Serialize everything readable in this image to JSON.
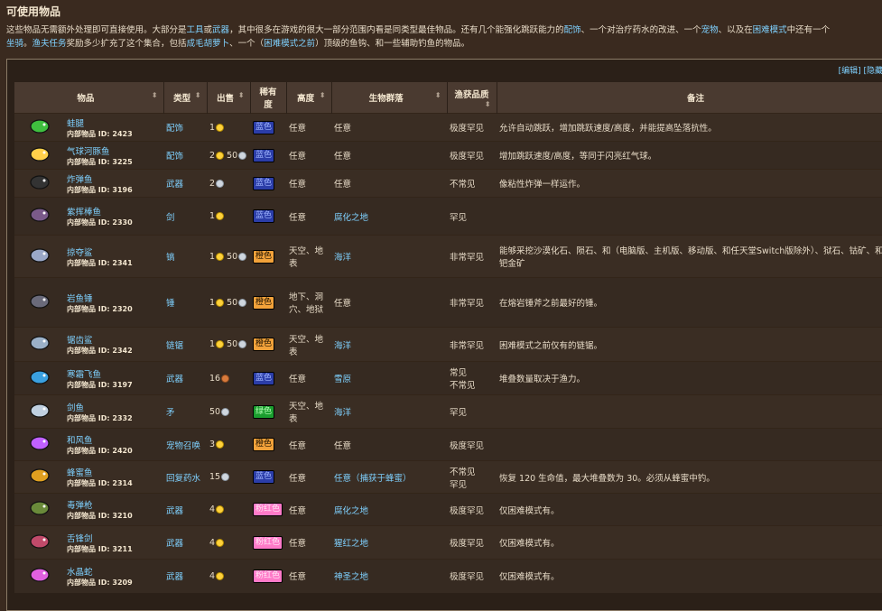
{
  "section_title": "可使用物品",
  "intro": {
    "line1_a": "这些物品无需额外处理即可直接使用。大部分是",
    "line1_link1": "工具",
    "line1_b": "或",
    "line1_link2": "武器",
    "line1_c": "，其中很多在游戏的很大一部分范围内看是同类型最佳物品。还有几个能强化跳跃能力的",
    "line1_link3": "配饰",
    "line1_d": "、一个对治疗药水的改进、一个",
    "line1_link4": "宠物",
    "line1_e": "、以及在",
    "line1_link5": "困难模式",
    "line1_f": "中还有一个",
    "line2_link1": "坐骑",
    "line2_a": "。",
    "line2_link2": "渔夫任务",
    "line2_b": "奖励多少扩充了这个集合，包括",
    "line2_link3": "成毛胡萝卜",
    "line2_c": "、一个（",
    "line2_link4": "困难模式之前",
    "line2_d": "）顶级的鱼钩、和一些辅助钓鱼的物品。"
  },
  "edit_links": {
    "edit": "[编辑]",
    "hide": "[隐藏"
  },
  "table": {
    "headers": {
      "item": "物品",
      "type": "类型",
      "sell": "出售",
      "rarity": "稀有度",
      "height": "高度",
      "biome": "生物群落",
      "quality": "渔获品质",
      "notes": "备注"
    },
    "rows": [
      {
        "name": "蛙腿",
        "id_label": "内部物品 ID:",
        "id": "2423",
        "type": "配饰",
        "sell": "1",
        "coin": "gold",
        "rarity": "蓝色",
        "rarity_class": "r-blue",
        "height": "任意",
        "biome": "任意",
        "quality": "极度罕见",
        "notes": "允许自动跳跃，增加跳跃速度/高度，并能提高坠落抗性。",
        "icon": "frog-leg-icon",
        "icon_color": "#3fbf3f"
      },
      {
        "name": "气球河豚鱼",
        "id_label": "内部物品 ID:",
        "id": "3225",
        "type": "配饰",
        "sell": "2",
        "sell2": "50",
        "coin": "gold",
        "rarity": "蓝色",
        "rarity_class": "r-blue",
        "height": "任意",
        "biome": "任意",
        "quality": "极度罕见",
        "notes": "增加跳跃速度/高度，等同于闪亮红气球。",
        "icon": "balloon-pufferfish-icon",
        "icon_color": "#ffd04a"
      },
      {
        "name": "炸弹鱼",
        "id_label": "内部物品 ID:",
        "id": "3196",
        "type": "武器",
        "sell": "2",
        "coin": "silver",
        "rarity": "蓝色",
        "rarity_class": "r-blue",
        "height": "任意",
        "biome": "任意",
        "quality": "不常见",
        "notes": "像粘性炸弹一样运作。",
        "icon": "bomb-fish-icon",
        "icon_color": "#333333"
      },
      {
        "name": "紫挥棒鱼",
        "id_label": "内部物品 ID:",
        "id": "2330",
        "type": "剑",
        "sell": "1",
        "coin": "gold",
        "rarity": "蓝色",
        "rarity_class": "r-blue",
        "height": "任意",
        "biome": "腐化之地",
        "quality": "罕见",
        "notes": "",
        "icon": "purple-clubberfish-icon",
        "icon_color": "#7a5a8a"
      },
      {
        "name": "掠夺鲨",
        "id_label": "内部物品 ID:",
        "id": "2341",
        "type": "镐",
        "sell": "1",
        "sell2": "50",
        "coin": "gold",
        "rarity": "橙色",
        "rarity_class": "r-orange",
        "height": "天空、地表",
        "biome": "海洋",
        "quality": "非常罕见",
        "notes": "能够采挖沙漠化石、陨石、和（电脑版、主机版、移动版、和任天堂Switch版除外）、狱石、钴矿、和钯金矿",
        "icon": "reaver-shark-icon",
        "icon_color": "#9aa8c8"
      },
      {
        "name": "岩鱼锤",
        "id_label": "内部物品 ID:",
        "id": "2320",
        "type": "锤",
        "sell": "1",
        "sell2": "50",
        "coin": "gold",
        "rarity": "橙色",
        "rarity_class": "r-orange",
        "height": "地下、洞穴、地狱",
        "biome": "任意",
        "quality": "非常罕见",
        "notes": "在熔岩锤斧之前最好的锤。",
        "icon": "rockfish-icon",
        "icon_color": "#6a6a7a"
      },
      {
        "name": "锯齿鲨",
        "id_label": "内部物品 ID:",
        "id": "2342",
        "type": "链锯",
        "sell": "1",
        "sell2": "50",
        "coin": "gold",
        "rarity": "橙色",
        "rarity_class": "r-orange",
        "height": "天空、地表",
        "biome": "海洋",
        "quality": "非常罕见",
        "notes": "困难模式之前仅有的链锯。",
        "icon": "sawtooth-shark-icon",
        "icon_color": "#9ab0c8"
      },
      {
        "name": "寒霜飞鱼",
        "id_label": "内部物品 ID:",
        "id": "3197",
        "type": "武器",
        "sell": "16",
        "coin": "copper",
        "rarity": "蓝色",
        "rarity_class": "r-blue",
        "height": "任意",
        "biome": "雪原",
        "quality": "常见\n不常见",
        "notes": "堆叠数量取决于渔力。",
        "icon": "frost-daggerfish-icon",
        "icon_color": "#3aa0e0"
      },
      {
        "name": "剑鱼",
        "id_label": "内部物品 ID:",
        "id": "2332",
        "type": "矛",
        "sell": "50",
        "coin": "silver",
        "rarity": "绿色",
        "rarity_class": "r-green",
        "height": "天空、地表",
        "biome": "海洋",
        "quality": "罕见",
        "notes": "",
        "icon": "swordfish-icon",
        "icon_color": "#c0d0e0"
      },
      {
        "name": "和风鱼",
        "id_label": "内部物品 ID:",
        "id": "2420",
        "type": "宠物召唤",
        "sell": "3",
        "coin": "gold",
        "rarity": "橙色",
        "rarity_class": "r-orange",
        "height": "任意",
        "biome": "任意",
        "quality": "极度罕见",
        "notes": "",
        "icon": "zephyr-fish-icon",
        "icon_color": "#c060ff"
      },
      {
        "name": "蜂蜜鱼",
        "id_label": "内部物品 ID:",
        "id": "2314",
        "type": "回复药水",
        "sell": "15",
        "coin": "silver",
        "rarity": "蓝色",
        "rarity_class": "r-blue",
        "height": "任意",
        "biome": "任意（捕获于蜂蜜）",
        "quality": "不常见\n罕见",
        "notes": "恢复 120 生命值，最大堆叠数为 30。必须从蜂蜜中钓。",
        "icon": "honeyfin-icon",
        "icon_color": "#e0a020"
      },
      {
        "name": "毒弹枪",
        "id_label": "内部物品 ID:",
        "id": "3210",
        "type": "武器",
        "sell": "4",
        "coin": "gold",
        "rarity": "粉红色",
        "rarity_class": "r-pink",
        "height": "任意",
        "biome": "腐化之地",
        "quality": "极度罕见",
        "notes": "仅困难模式有。",
        "icon": "toxikarp-icon",
        "icon_color": "#6a8a3a"
      },
      {
        "name": "舌锋剑",
        "id_label": "内部物品 ID:",
        "id": "3211",
        "type": "武器",
        "sell": "4",
        "coin": "gold",
        "rarity": "粉红色",
        "rarity_class": "r-pink",
        "height": "任意",
        "biome": "猩红之地",
        "quality": "极度罕见",
        "notes": "仅困难模式有。",
        "icon": "bladetongue-icon",
        "icon_color": "#c04a6a"
      },
      {
        "name": "水晶蛇",
        "id_label": "内部物品 ID:",
        "id": "3209",
        "type": "武器",
        "sell": "4",
        "coin": "gold",
        "rarity": "粉红色",
        "rarity_class": "r-pink",
        "height": "任意",
        "biome": "神圣之地",
        "quality": "极度罕见",
        "notes": "仅困难模式有。",
        "icon": "crystal-serpent-icon",
        "icon_color": "#e060e0"
      }
    ]
  }
}
